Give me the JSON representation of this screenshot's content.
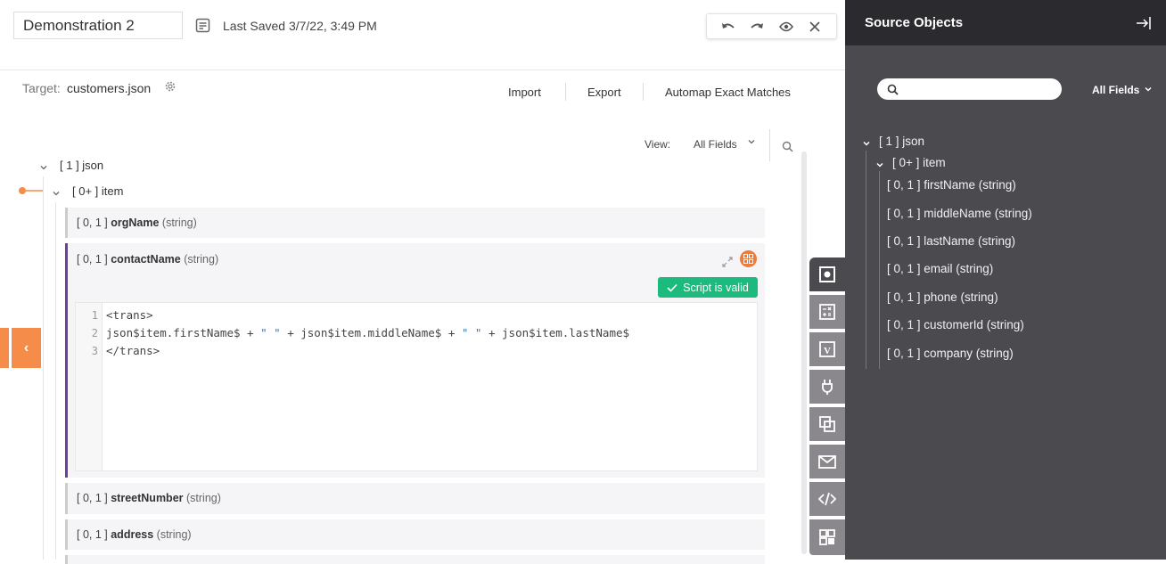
{
  "header": {
    "title_value": "Demonstration 2",
    "last_saved": "Last Saved 3/7/22, 3:49 PM",
    "toolbar_icons": [
      "undo-icon",
      "redo-icon",
      "preview-eye-icon",
      "close-icon"
    ]
  },
  "target": {
    "label": "Target:",
    "value": "customers.json"
  },
  "actions": {
    "import": "Import",
    "export": "Export",
    "automap": "Automap Exact Matches"
  },
  "view": {
    "label": "View:",
    "selected": "All Fields"
  },
  "target_tree": {
    "root": "[ 1 ] json",
    "item": "[ 0+ ] item",
    "fields": [
      {
        "card": "[ 0, 1 ]",
        "name": "orgName",
        "type": "(string)"
      },
      {
        "card": "[ 0, 1 ]",
        "name": "contactName",
        "type": "(string)"
      },
      {
        "card": "[ 0, 1 ]",
        "name": "streetNumber",
        "type": "(string)"
      },
      {
        "card": "[ 0, 1 ]",
        "name": "address",
        "type": "(string)"
      }
    ]
  },
  "script": {
    "status": "Script is valid",
    "status_color": "#1dba7e",
    "lines": [
      {
        "num": "1",
        "text": "<trans>"
      },
      {
        "num": "2",
        "parts": [
          "json$item.firstName$ + ",
          "\" \"",
          " + json$item.middleName$ + ",
          "\" \"",
          " + json$item.lastName$"
        ]
      },
      {
        "num": "3",
        "text": "</trans>"
      }
    ]
  },
  "side_tabs": [
    "active-field-icon",
    "formula-icon",
    "variable-icon",
    "plugin-icon",
    "objects-icon",
    "notification-icon",
    "script-code-icon",
    "components-icon"
  ],
  "source_panel": {
    "title": "Source Objects",
    "search_placeholder": "",
    "filter": "All Fields",
    "root": "[ 1 ] json",
    "item": "[ 0+ ] item",
    "fields": [
      "[ 0, 1 ] firstName (string)",
      "[ 0, 1 ] middleName (string)",
      "[ 0, 1 ] lastName (string)",
      "[ 0, 1 ] email (string)",
      "[ 0, 1 ] phone (string)",
      "[ 0, 1 ] customerId (string)",
      "[ 0, 1 ] company (string)"
    ]
  },
  "colors": {
    "accent_orange": "#f68c4a",
    "active_purple": "#6b3fa0",
    "panel_dark": "#4b4a4f",
    "panel_header": "#2b2a2e"
  }
}
